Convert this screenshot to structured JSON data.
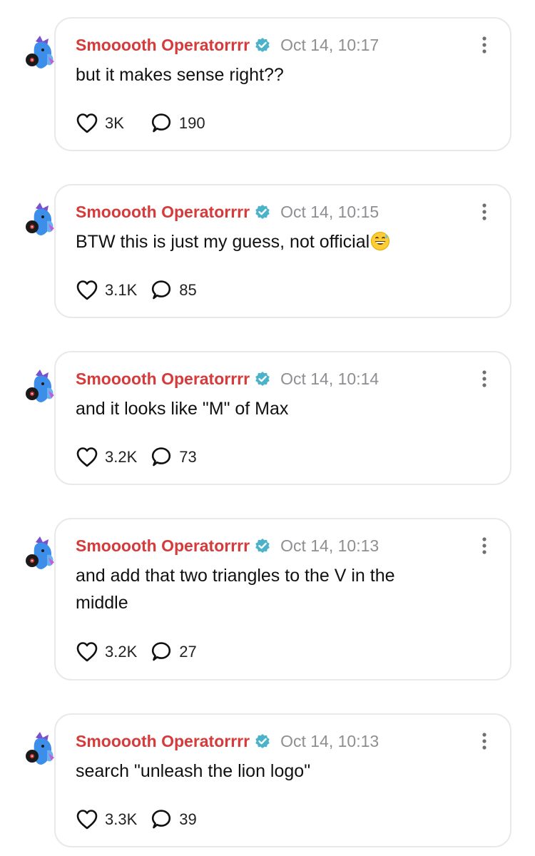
{
  "icons": {
    "avatar": "avatar-image",
    "verified": "verified-badge-icon",
    "more": "more-vertical-icon",
    "like": "heart-icon",
    "reply": "speech-bubble-icon",
    "emoji": "grinning-face-with-sweat-emoji"
  },
  "colors": {
    "author": "#d63a3a",
    "verified_badge": "#4ab3c9",
    "timestamp": "#8e8e93",
    "card_border": "#e9e9ec"
  },
  "posts": [
    {
      "author": "Smooooth Operatorrrr",
      "timestamp": "Oct 14, 10:17",
      "text": "but it makes sense right??",
      "likes": "3K",
      "replies": "190"
    },
    {
      "author": "Smooooth Operatorrrr",
      "timestamp": "Oct 14, 10:15",
      "text": "BTW this is just my guess, not official",
      "likes": "3.1K",
      "replies": "85"
    },
    {
      "author": "Smooooth Operatorrrr",
      "timestamp": "Oct 14, 10:14",
      "text": "and it looks like \"M\" of Max",
      "likes": "3.2K",
      "replies": "73"
    },
    {
      "author": "Smooooth Operatorrrr",
      "timestamp": "Oct 14, 10:13",
      "text": "and add that two triangles to the V in the middle",
      "likes": "3.2K",
      "replies": "27"
    },
    {
      "author": "Smooooth Operatorrrr",
      "timestamp": "Oct 14, 10:13",
      "text": "search \"unleash the lion logo\"",
      "likes": "3.3K",
      "replies": "39"
    }
  ]
}
